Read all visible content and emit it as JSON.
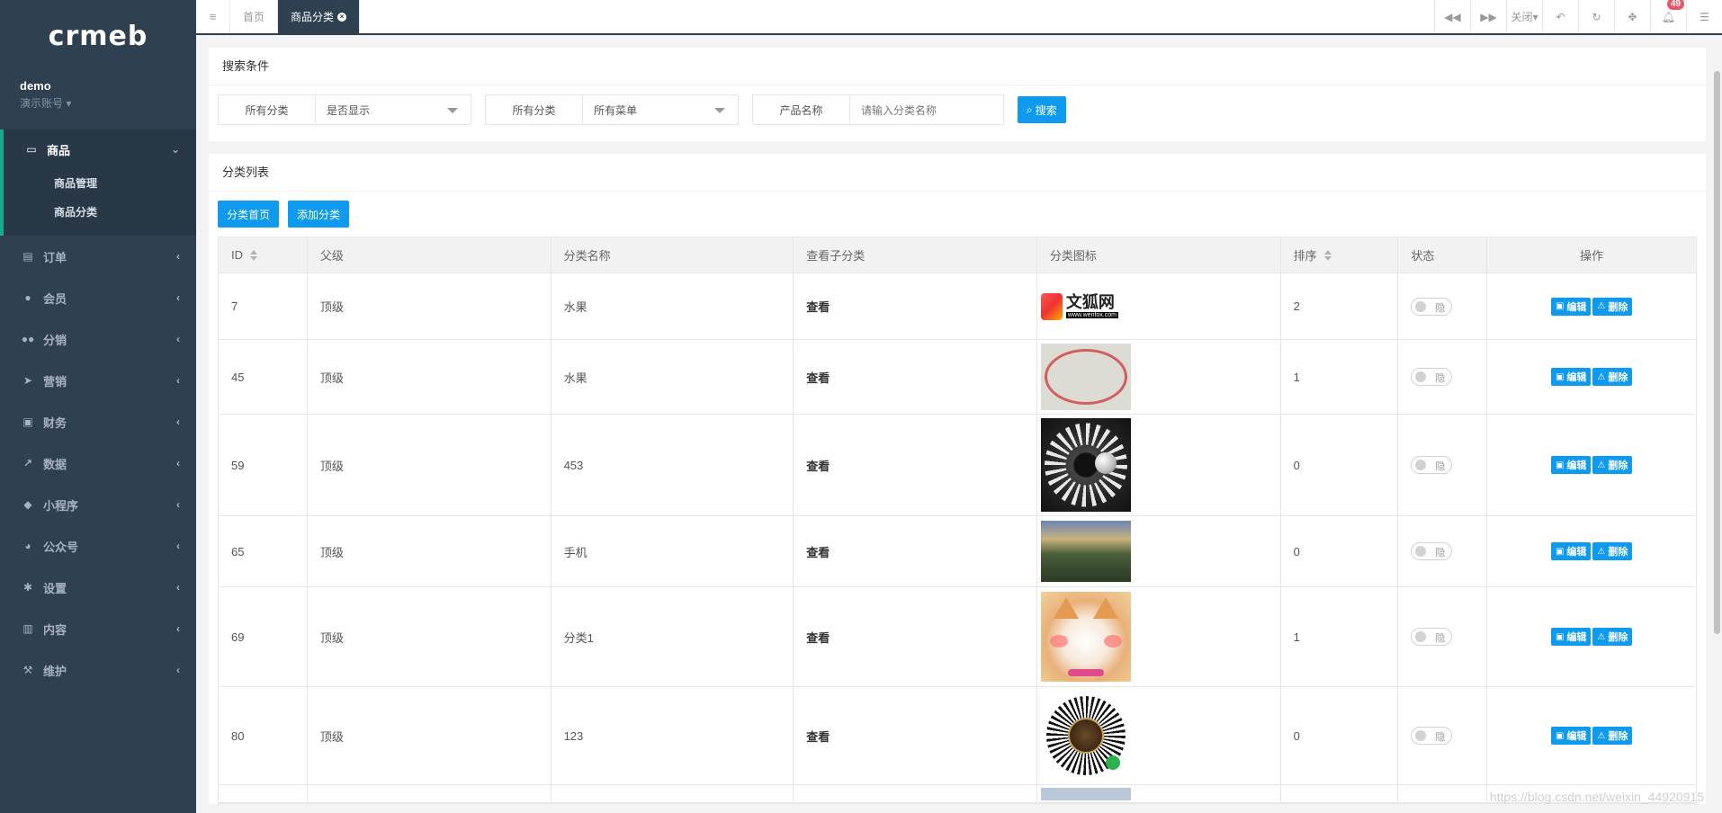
{
  "sidebar": {
    "logo": "crmeb",
    "user": {
      "name": "demo",
      "role": "演示账号"
    },
    "active_group": {
      "label": "商品",
      "items": [
        "商品管理",
        "商品分类"
      ]
    },
    "items": [
      {
        "label": "订单",
        "icon": "order-icon"
      },
      {
        "label": "会员",
        "icon": "user-icon"
      },
      {
        "label": "分销",
        "icon": "users-icon"
      },
      {
        "label": "营销",
        "icon": "send-icon"
      },
      {
        "label": "财务",
        "icon": "money-icon"
      },
      {
        "label": "数据",
        "icon": "chart-icon"
      },
      {
        "label": "小程序",
        "icon": "cubes-icon"
      },
      {
        "label": "公众号",
        "icon": "wechat-icon"
      },
      {
        "label": "设置",
        "icon": "gear-icon"
      },
      {
        "label": "内容",
        "icon": "book-icon"
      },
      {
        "label": "维护",
        "icon": "wrench-icon"
      }
    ]
  },
  "topbar": {
    "tabs": [
      {
        "label": "首页",
        "active": false
      },
      {
        "label": "商品分类",
        "active": true
      }
    ],
    "close_label": "关闭",
    "notification_count": "49"
  },
  "search": {
    "title": "搜索条件",
    "groups": [
      {
        "addon": "所有分类",
        "value": "是否显示",
        "type": "select"
      },
      {
        "addon": "所有分类",
        "value": "所有菜单",
        "type": "select"
      },
      {
        "addon": "产品名称",
        "placeholder": "请输入分类名称",
        "type": "input"
      }
    ],
    "button": "搜索"
  },
  "list": {
    "title": "分类列表",
    "buttons": [
      "分类首页",
      "添加分类"
    ],
    "columns": [
      "ID",
      "父级",
      "分类名称",
      "查看子分类",
      "分类图标",
      "排序",
      "状态",
      "操作"
    ],
    "rows": [
      {
        "id": "7",
        "parent": "顶级",
        "name": "水果",
        "view": "查看",
        "icon": "logo",
        "sort": "2",
        "status": "隐"
      },
      {
        "id": "45",
        "parent": "顶级",
        "name": "水果",
        "view": "查看",
        "icon": "stamp",
        "sort": "1",
        "status": "隐"
      },
      {
        "id": "59",
        "parent": "顶级",
        "name": "453",
        "view": "查看",
        "icon": "dark",
        "sort": "0",
        "status": "隐"
      },
      {
        "id": "65",
        "parent": "顶级",
        "name": "手机",
        "view": "查看",
        "icon": "land",
        "sort": "0",
        "status": "隐"
      },
      {
        "id": "69",
        "parent": "顶级",
        "name": "分类1",
        "view": "查看",
        "icon": "cat",
        "sort": "1",
        "status": "隐"
      },
      {
        "id": "80",
        "parent": "顶级",
        "name": "123",
        "view": "查看",
        "icon": "qr",
        "sort": "0",
        "status": "隐"
      }
    ],
    "edit_label": "编辑",
    "delete_label": "删除",
    "thumb_texts": {
      "logo_big": "文狐网",
      "logo_small": "www.wenfox.com"
    }
  },
  "watermark": "https://blog.csdn.net/weixin_44920915",
  "colors": {
    "sidebar": "#2f4050",
    "primary": "#0e9aef",
    "badge": "#ed5565"
  }
}
